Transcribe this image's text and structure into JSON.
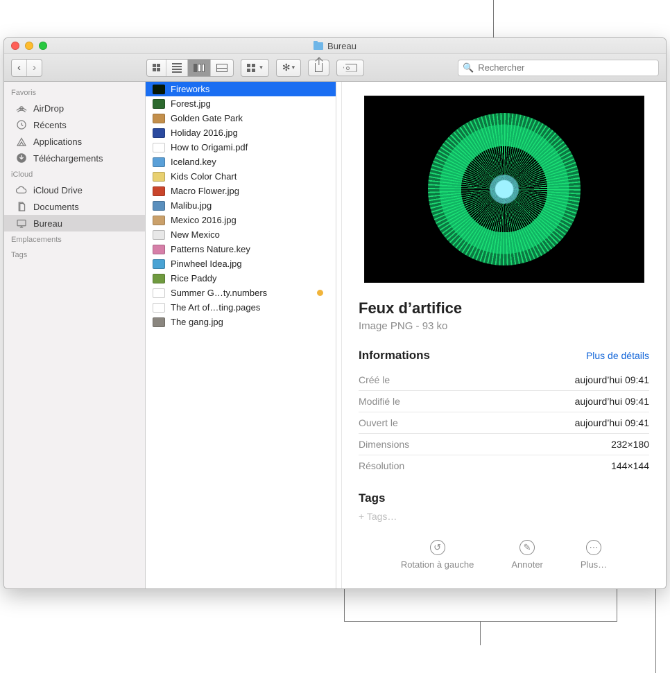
{
  "window": {
    "title": "Bureau"
  },
  "search": {
    "placeholder": "Rechercher"
  },
  "sidebar": {
    "sections": [
      {
        "title": "Favoris",
        "items": [
          {
            "label": "AirDrop"
          },
          {
            "label": "Récents"
          },
          {
            "label": "Applications"
          },
          {
            "label": "Téléchargements"
          }
        ]
      },
      {
        "title": "iCloud",
        "items": [
          {
            "label": "iCloud Drive"
          },
          {
            "label": "Documents"
          },
          {
            "label": "Bureau",
            "selected": true
          }
        ]
      },
      {
        "title": "Emplacements",
        "items": []
      },
      {
        "title": "Tags",
        "items": []
      }
    ]
  },
  "files": [
    {
      "name": "Fireworks",
      "selected": true,
      "thumb": "#071a07"
    },
    {
      "name": "Forest.jpg",
      "thumb": "#2d6a2f"
    },
    {
      "name": "Golden Gate Park",
      "thumb": "#c38f4b"
    },
    {
      "name": "Holiday 2016.jpg",
      "thumb": "#2b4a9f"
    },
    {
      "name": "How to Origami.pdf",
      "thumb": "#ffffff"
    },
    {
      "name": "Iceland.key",
      "thumb": "#5aa0d8"
    },
    {
      "name": "Kids Color Chart",
      "thumb": "#e8d070"
    },
    {
      "name": "Macro Flower.jpg",
      "thumb": "#c9452b"
    },
    {
      "name": "Malibu.jpg",
      "thumb": "#5a8fbd"
    },
    {
      "name": "Mexico 2016.jpg",
      "thumb": "#caa06a"
    },
    {
      "name": "New Mexico",
      "thumb": "#e8e8e8"
    },
    {
      "name": "Patterns Nature.key",
      "thumb": "#d67fa8"
    },
    {
      "name": "Pinwheel Idea.jpg",
      "thumb": "#4aa3d4"
    },
    {
      "name": "Rice Paddy",
      "thumb": "#6f9a3f"
    },
    {
      "name": "Summer G…ty.numbers",
      "thumb": "#ffffff",
      "tagged": true
    },
    {
      "name": "The Art of…ting.pages",
      "thumb": "#ffffff"
    },
    {
      "name": "The gang.jpg",
      "thumb": "#8a867f"
    }
  ],
  "preview": {
    "title": "Feux d’artifice",
    "subtitle": "Image PNG - 93 ko",
    "info_header": "Informations",
    "more_link": "Plus de détails",
    "rows": [
      {
        "k": "Créé le",
        "v": "aujourd’hui 09:41"
      },
      {
        "k": "Modifié le",
        "v": "aujourd’hui 09:41"
      },
      {
        "k": "Ouvert le",
        "v": "aujourd’hui 09:41"
      },
      {
        "k": "Dimensions",
        "v": "232×180"
      },
      {
        "k": "Résolution",
        "v": "144×144"
      }
    ],
    "tags_header": "Tags",
    "tags_placeholder": "+ Tags…",
    "actions": {
      "rotate": "Rotation à gauche",
      "annotate": "Annoter",
      "more": "Plus…"
    }
  }
}
